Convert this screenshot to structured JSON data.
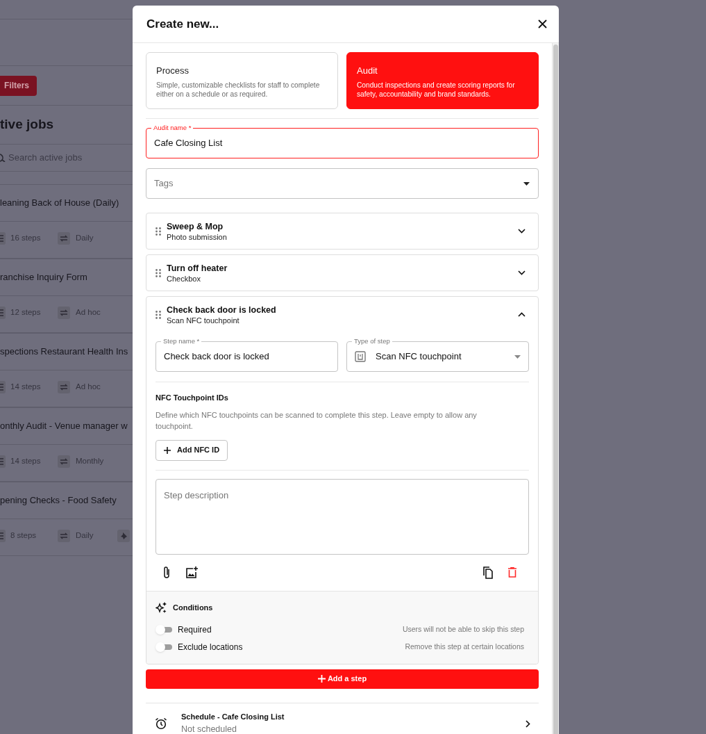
{
  "background": {
    "filters_button": "Filters",
    "heading": "tive jobs",
    "search_placeholder": "Search active jobs",
    "jobs": [
      {
        "title": "leaning Back of House (Daily)",
        "steps": "16 steps",
        "frequency": "Daily",
        "pinned": false
      },
      {
        "title": "ranchise Inquiry Form",
        "steps": "12 steps",
        "frequency": "Ad hoc",
        "pinned": false
      },
      {
        "title": "spections Restaurant Health Ins",
        "steps": "14 steps",
        "frequency": "Ad hoc",
        "pinned": false
      },
      {
        "title": "onthly Audit - Venue manager w",
        "steps": "14 steps",
        "frequency": "Monthly",
        "pinned": false
      },
      {
        "title": "pening Checks - Food Safety",
        "steps": "8 steps",
        "frequency": "Daily",
        "pinned": true
      }
    ]
  },
  "dialog": {
    "title": "Create new...",
    "types": [
      {
        "title": "Process",
        "description": "Simple, customizable checklists for staff to complete either on a schedule or as required.",
        "selected": false
      },
      {
        "title": "Audit",
        "description": "Conduct inspections and create scoring reports for safety, accountability and brand standards.",
        "selected": true
      }
    ],
    "name_field": {
      "label": "Audit name *",
      "value": "Cafe Closing List"
    },
    "tags_field": {
      "placeholder": "Tags"
    },
    "steps": [
      {
        "title": "Sweep & Mop",
        "type": "Photo submission",
        "expanded": false
      },
      {
        "title": "Turn off heater",
        "type": "Checkbox",
        "expanded": false
      },
      {
        "title": "Check back door is locked",
        "type": "Scan NFC touchpoint",
        "expanded": true,
        "details": {
          "step_name_label": "Step name *",
          "step_name_value": "Check back door is locked",
          "type_label": "Type of step",
          "type_value": "Scan NFC touchpoint",
          "nfc_heading": "NFC Touchpoint IDs",
          "nfc_description": "Define which NFC touchpoints can be scanned to complete this step. Leave empty to allow any touchpoint.",
          "add_nfc_button": "Add NFC ID",
          "description_placeholder": "Step description",
          "conditions_heading": "Conditions",
          "conditions": [
            {
              "label": "Required",
              "hint": "Users will not be able to skip this step",
              "on": false
            },
            {
              "label": "Exclude locations",
              "hint": "Remove this step at certain locations",
              "on": false
            }
          ]
        }
      }
    ],
    "add_step_button": "Add a step",
    "schedule": {
      "title": "Schedule - Cafe Closing List",
      "subtitle": "Not scheduled"
    }
  }
}
